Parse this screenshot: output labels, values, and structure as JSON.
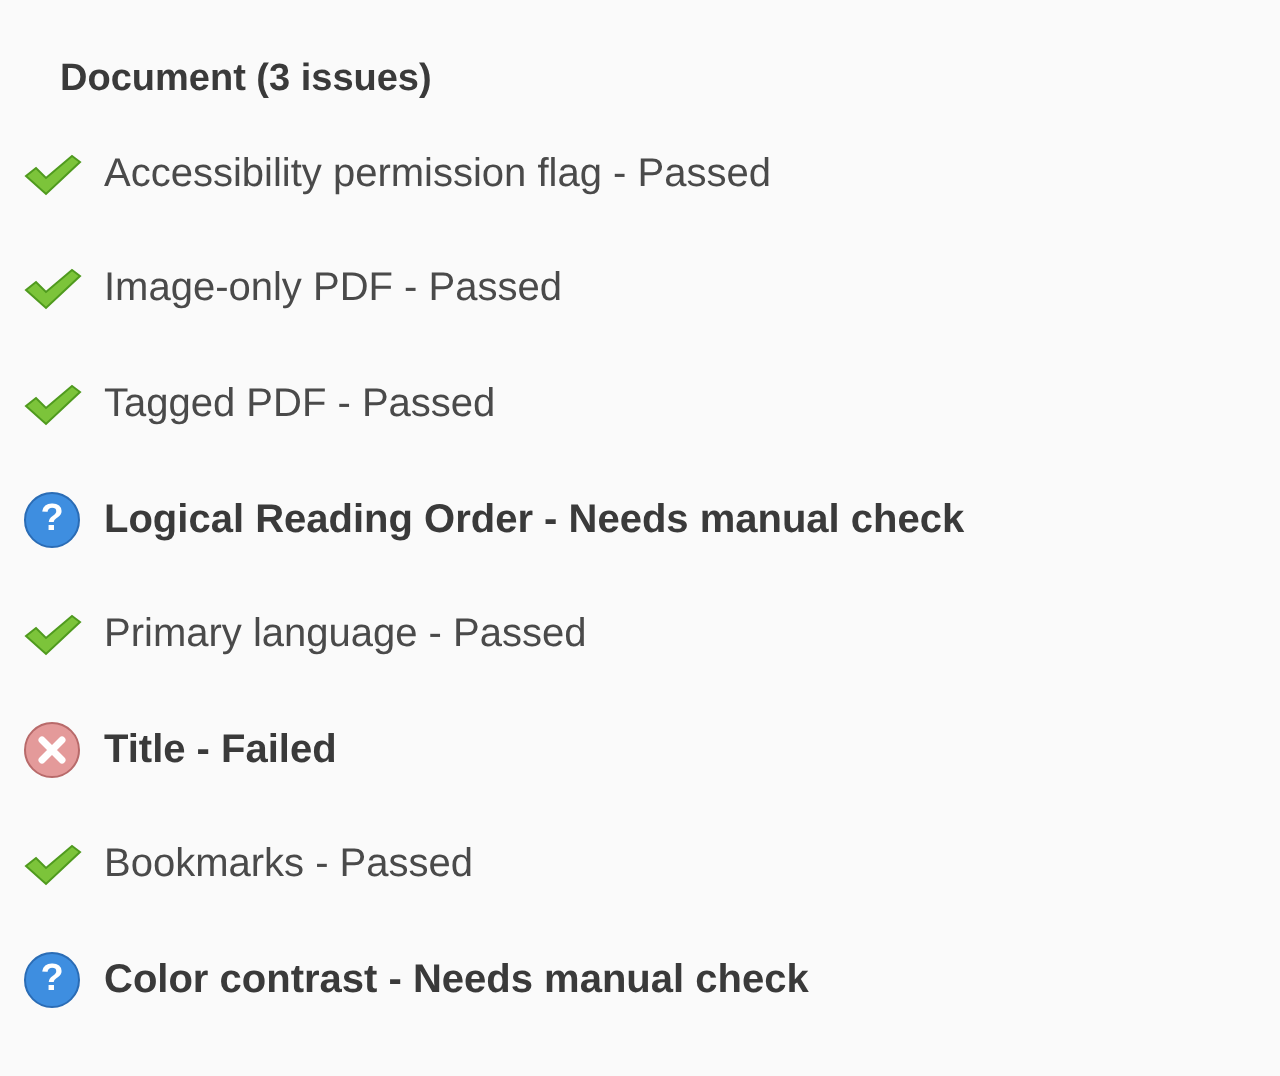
{
  "section": {
    "title": "Document (3 issues)"
  },
  "checks": [
    {
      "kind": "passed",
      "label": "Accessibility permission flag - Passed"
    },
    {
      "kind": "passed",
      "label": "Image-only PDF - Passed"
    },
    {
      "kind": "passed",
      "label": "Tagged PDF - Passed"
    },
    {
      "kind": "manual",
      "label": "Logical Reading Order - Needs manual check",
      "icon_glyph": "?"
    },
    {
      "kind": "passed",
      "label": "Primary language - Passed"
    },
    {
      "kind": "failed",
      "label": "Title - Failed"
    },
    {
      "kind": "passed",
      "label": "Bookmarks - Passed"
    },
    {
      "kind": "manual",
      "label": "Color contrast - Needs manual check",
      "icon_glyph": "?"
    }
  ]
}
